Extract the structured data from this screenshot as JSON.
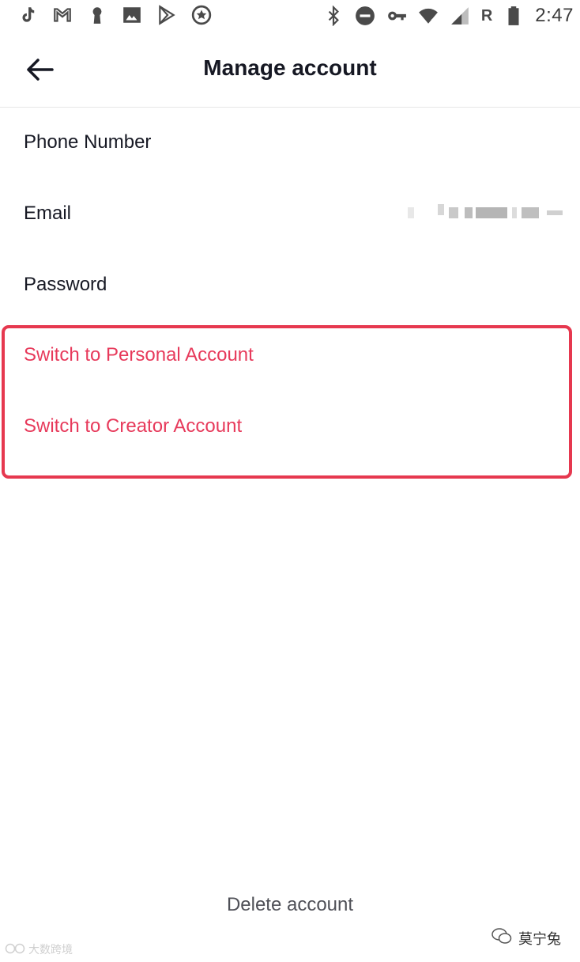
{
  "status_bar": {
    "time": "2:47",
    "roaming": "R",
    "left_icons": [
      "tiktok-icon",
      "gmail-icon",
      "keyhole-icon",
      "photo-icon",
      "play-store-icon",
      "badge-icon"
    ],
    "right_icons": [
      "bluetooth-icon",
      "do-not-disturb-icon",
      "vpn-key-icon",
      "wifi-icon",
      "signal-icon",
      "battery-icon"
    ]
  },
  "header": {
    "title": "Manage account",
    "back_icon": "arrow-left-icon"
  },
  "menu": {
    "items": [
      {
        "label": "Phone Number"
      },
      {
        "label": "Email"
      },
      {
        "label": "Password"
      },
      {
        "label": "Switch to Personal Account"
      },
      {
        "label": "Switch to Creator Account"
      }
    ]
  },
  "footer": {
    "delete_label": "Delete account"
  },
  "watermarks": {
    "left": "大数跨境",
    "right": "莫宁兔"
  },
  "colors": {
    "accent_red": "#e73a5b",
    "highlight_border": "#e6384f",
    "text_primary": "#161823"
  }
}
